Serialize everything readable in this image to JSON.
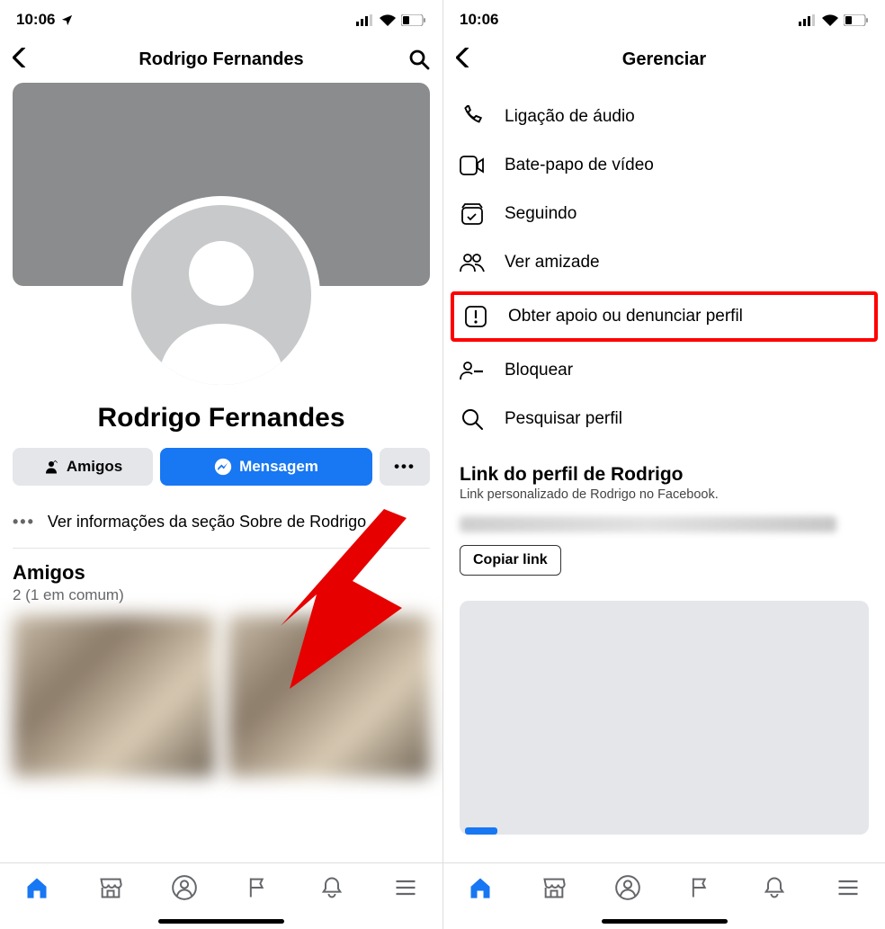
{
  "status": {
    "time": "10:06",
    "time_right": "10:06"
  },
  "left": {
    "header_title": "Rodrigo Fernandes",
    "profile_name": "Rodrigo Fernandes",
    "friends_label": "Amigos",
    "message_label": "Mensagem",
    "more_label": "•••",
    "about_label": "Ver informações da seção Sobre de Rodrigo",
    "about_dots": "•••",
    "friends_section_title": "Amigos",
    "friends_count": "2 (1 em comum)"
  },
  "right": {
    "header_title": "Gerenciar",
    "items": [
      {
        "label": "Ligação de áudio",
        "icon": "phone"
      },
      {
        "label": "Bate-papo de vídeo",
        "icon": "video"
      },
      {
        "label": "Seguindo",
        "icon": "following"
      },
      {
        "label": "Ver amizade",
        "icon": "friendship"
      },
      {
        "label": "Obter apoio ou denunciar perfil",
        "icon": "report",
        "highlighted": true
      },
      {
        "label": "Bloquear",
        "icon": "block"
      },
      {
        "label": "Pesquisar perfil",
        "icon": "search"
      }
    ],
    "link_section_title": "Link do perfil de Rodrigo",
    "link_section_subtitle": "Link personalizado de Rodrigo no Facebook.",
    "copy_button": "Copiar link"
  }
}
